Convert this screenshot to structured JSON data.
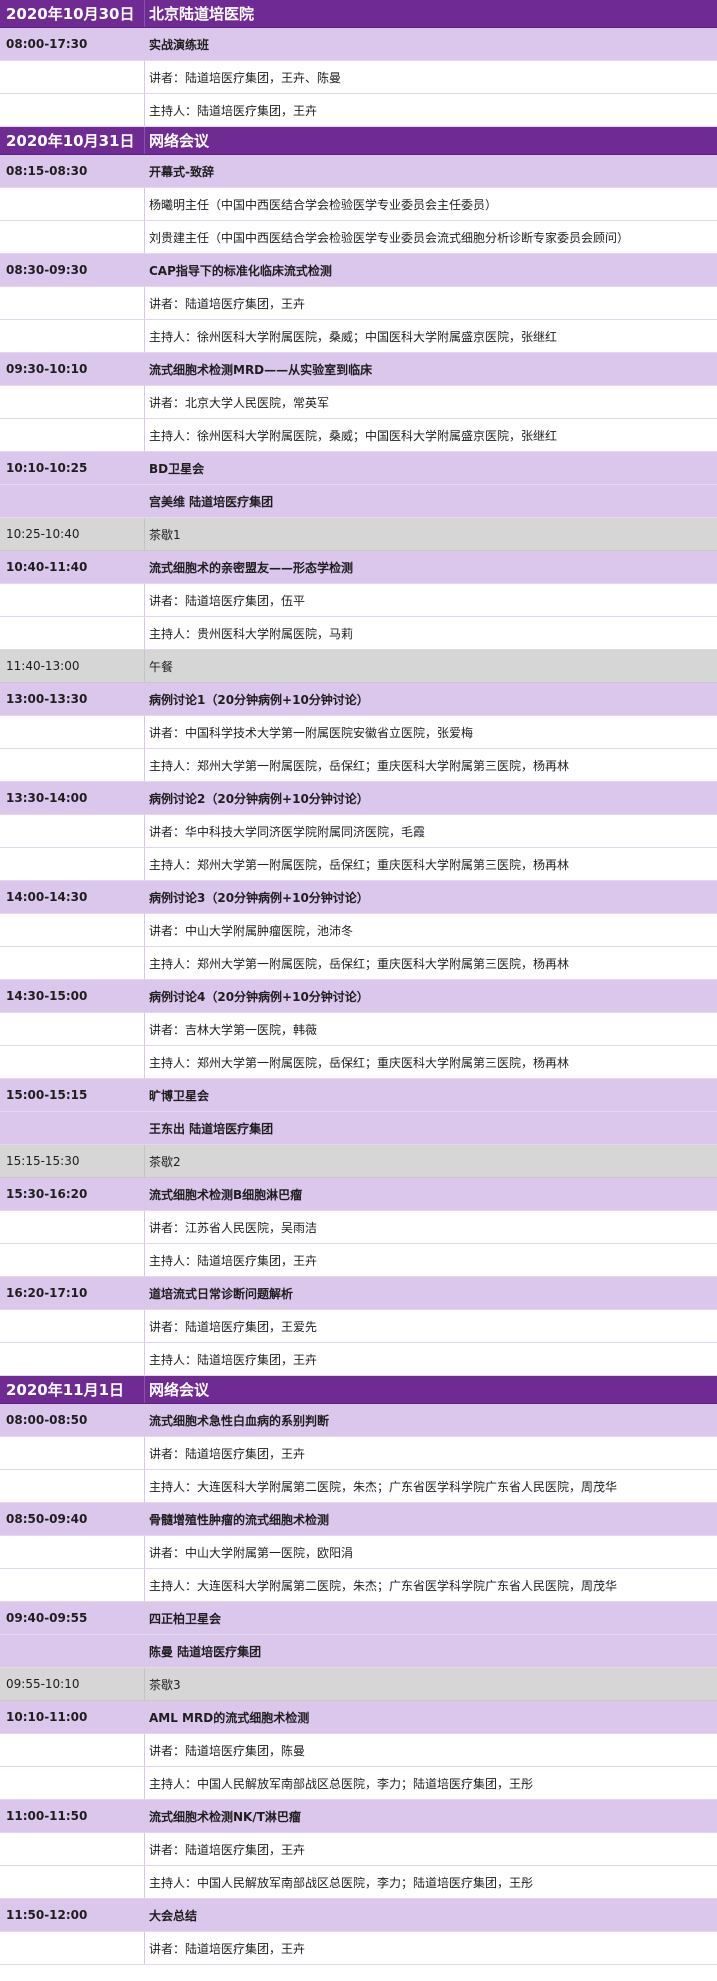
{
  "rows": [
    {
      "type": "header",
      "time": "2020年10月30日",
      "title": "北京陆道培医院"
    },
    {
      "type": "session",
      "time": "08:00-17:30",
      "title": "实战演练班"
    },
    {
      "type": "sub",
      "time": "",
      "title": "讲者：陆道培医疗集团，王卉、陈曼"
    },
    {
      "type": "sub",
      "time": "",
      "title": "主持人：陆道培医疗集团，王卉"
    },
    {
      "type": "header",
      "time": "2020年10月31日",
      "title": "网络会议"
    },
    {
      "type": "session",
      "time": "08:15-08:30",
      "title": "开幕式-致辞"
    },
    {
      "type": "sub",
      "time": "",
      "title": "杨曦明主任（中国中西医结合学会检验医学专业委员会主任委员）"
    },
    {
      "type": "sub",
      "time": "",
      "title": "刘贵建主任（中国中西医结合学会检验医学专业委员会流式细胞分析诊断专家委员会顾问）"
    },
    {
      "type": "session",
      "time": "08:30-09:30",
      "title": "CAP指导下的标准化临床流式检测"
    },
    {
      "type": "sub",
      "time": "",
      "title": "讲者：陆道培医疗集团，王卉"
    },
    {
      "type": "sub",
      "time": "",
      "title": "主持人：徐州医科大学附属医院，桑威；中国医科大学附属盛京医院，张继红"
    },
    {
      "type": "session",
      "time": "09:30-10:10",
      "title": "流式细胞术检测MRD——从实验室到临床"
    },
    {
      "type": "sub",
      "time": "",
      "title": "讲者：北京大学人民医院，常英军"
    },
    {
      "type": "sub",
      "time": "",
      "title": "主持人：徐州医科大学附属医院，桑威；中国医科大学附属盛京医院，张继红"
    },
    {
      "type": "session",
      "time": "10:10-10:25",
      "title": "BD卫星会"
    },
    {
      "type": "session",
      "time": "",
      "title": "宫美维  陆道培医疗集团"
    },
    {
      "type": "break",
      "time": "10:25-10:40",
      "title": "茶歇1"
    },
    {
      "type": "session",
      "time": "10:40-11:40",
      "title": "流式细胞术的亲密盟友——形态学检测"
    },
    {
      "type": "sub",
      "time": "",
      "title": "讲者：陆道培医疗集团，伍平"
    },
    {
      "type": "sub",
      "time": "",
      "title": "主持人：贵州医科大学附属医院，马莉"
    },
    {
      "type": "break",
      "time": "11:40-13:00",
      "title": "午餐"
    },
    {
      "type": "session",
      "time": "13:00-13:30",
      "title": "病例讨论1（20分钟病例+10分钟讨论）"
    },
    {
      "type": "sub",
      "time": "",
      "title": "讲者：中国科学技术大学第一附属医院安徽省立医院，张爱梅"
    },
    {
      "type": "sub",
      "time": "",
      "title": "主持人：郑州大学第一附属医院，岳保红；重庆医科大学附属第三医院，杨再林"
    },
    {
      "type": "session",
      "time": "13:30-14:00",
      "title": "病例讨论2（20分钟病例+10分钟讨论）"
    },
    {
      "type": "sub",
      "time": "",
      "title": "讲者：华中科技大学同济医学院附属同济医院，毛霞"
    },
    {
      "type": "sub",
      "time": "",
      "title": "主持人：郑州大学第一附属医院，岳保红；重庆医科大学附属第三医院，杨再林"
    },
    {
      "type": "session",
      "time": "14:00-14:30",
      "title": "病例讨论3（20分钟病例+10分钟讨论）"
    },
    {
      "type": "sub",
      "time": "",
      "title": "讲者：中山大学附属肿瘤医院，池沛冬"
    },
    {
      "type": "sub",
      "time": "",
      "title": "主持人：郑州大学第一附属医院，岳保红；重庆医科大学附属第三医院，杨再林"
    },
    {
      "type": "session",
      "time": "14:30-15:00",
      "title": "病例讨论4（20分钟病例+10分钟讨论）"
    },
    {
      "type": "sub",
      "time": "",
      "title": "讲者：吉林大学第一医院，韩薇"
    },
    {
      "type": "sub",
      "time": "",
      "title": "主持人：郑州大学第一附属医院，岳保红；重庆医科大学附属第三医院，杨再林"
    },
    {
      "type": "session",
      "time": "15:00-15:15",
      "title": "旷博卫星会"
    },
    {
      "type": "session",
      "time": "",
      "title": "王东出  陆道培医疗集团"
    },
    {
      "type": "break",
      "time": "15:15-15:30",
      "title": "茶歇2"
    },
    {
      "type": "session",
      "time": "15:30-16:20",
      "title": "流式细胞术检测B细胞淋巴瘤"
    },
    {
      "type": "sub",
      "time": "",
      "title": "讲者：江苏省人民医院，吴雨洁"
    },
    {
      "type": "sub",
      "time": "",
      "title": "主持人：陆道培医疗集团，王卉"
    },
    {
      "type": "session",
      "time": "16:20-17:10",
      "title": "道培流式日常诊断问题解析"
    },
    {
      "type": "sub",
      "time": "",
      "title": "讲者：陆道培医疗集团，王爱先"
    },
    {
      "type": "sub",
      "time": "",
      "title": "主持人：陆道培医疗集团，王卉"
    },
    {
      "type": "header",
      "time": "2020年11月1日",
      "title": "网络会议"
    },
    {
      "type": "session",
      "time": "08:00-08:50",
      "title": "流式细胞术急性白血病的系别判断"
    },
    {
      "type": "sub",
      "time": "",
      "title": "讲者：陆道培医疗集团，王卉"
    },
    {
      "type": "sub",
      "time": "",
      "title": "主持人：大连医科大学附属第二医院，朱杰；广东省医学科学院广东省人民医院，周茂华"
    },
    {
      "type": "session",
      "time": "08:50-09:40",
      "title": "骨髓增殖性肿瘤的流式细胞术检测"
    },
    {
      "type": "sub",
      "time": "",
      "title": "讲者：中山大学附属第一医院，欧阳涓"
    },
    {
      "type": "sub",
      "time": "",
      "title": "主持人：大连医科大学附属第二医院，朱杰；广东省医学科学院广东省人民医院，周茂华"
    },
    {
      "type": "session",
      "time": "09:40-09:55",
      "title": "四正柏卫星会"
    },
    {
      "type": "session",
      "time": "",
      "title": "陈曼  陆道培医疗集团"
    },
    {
      "type": "break",
      "time": "09:55-10:10",
      "title": "茶歇3"
    },
    {
      "type": "session",
      "time": "10:10-11:00",
      "title": "AML MRD的流式细胞术检测"
    },
    {
      "type": "sub",
      "time": "",
      "title": "讲者：陆道培医疗集团，陈曼"
    },
    {
      "type": "sub",
      "time": "",
      "title": "主持人：中国人民解放军南部战区总医院，李力；陆道培医疗集团，王彤"
    },
    {
      "type": "session",
      "time": "11:00-11:50",
      "title": "流式细胞术检测NK/T淋巴瘤"
    },
    {
      "type": "sub",
      "time": "",
      "title": "讲者：陆道培医疗集团，王卉"
    },
    {
      "type": "sub",
      "time": "",
      "title": "主持人：中国人民解放军南部战区总医院，李力；陆道培医疗集团，王彤"
    },
    {
      "type": "session",
      "time": "11:50-12:00",
      "title": "大会总结"
    },
    {
      "type": "sub",
      "time": "",
      "title": "讲者：陆道培医疗集团，王卉"
    }
  ]
}
